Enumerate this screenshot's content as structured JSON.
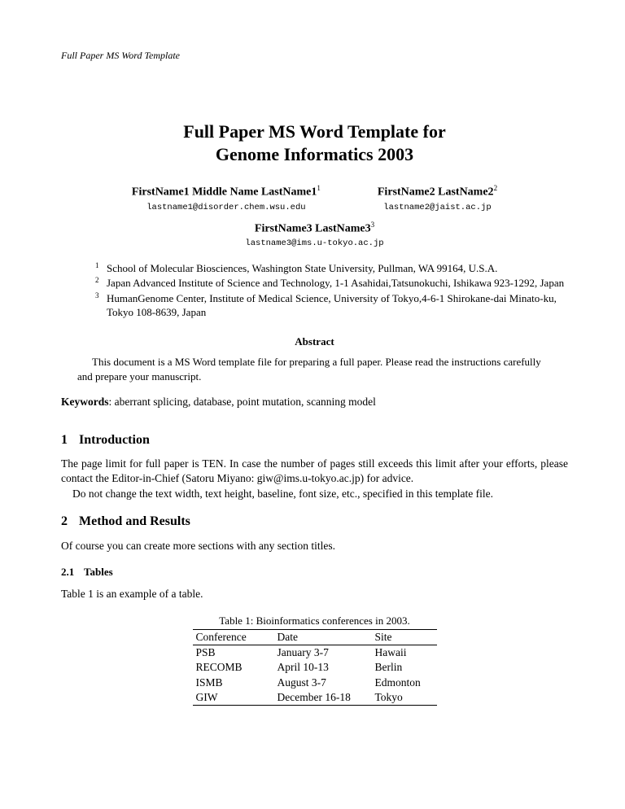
{
  "running_header": "Full Paper MS Word Template",
  "title_line1": "Full Paper MS Word Template for",
  "title_line2": "Genome Informatics 2003",
  "authors": [
    {
      "name": "FirstName1 Middle Name LastName1",
      "sup": "1",
      "email": "lastname1@disorder.chem.wsu.edu"
    },
    {
      "name": "FirstName2 LastName2",
      "sup": "2",
      "email": "lastname2@jaist.ac.jp"
    },
    {
      "name": "FirstName3 LastName3",
      "sup": "3",
      "email": "lastname3@ims.u-tokyo.ac.jp"
    }
  ],
  "affiliations": [
    {
      "sup": "1",
      "text": "School of Molecular Biosciences, Washington State University, Pullman, WA 99164, U.S.A."
    },
    {
      "sup": "2",
      "text": " Japan Advanced Institute of Science and Technology, 1-1 Asahidai,Tatsunokuchi, Ishikawa 923-1292, Japan"
    },
    {
      "sup": "3",
      "text": " HumanGenome Center, Institute of Medical Science, University of Tokyo,4-6-1 Shirokane-dai Minato-ku, Tokyo 108-8639, Japan"
    }
  ],
  "abstract": {
    "heading": "Abstract",
    "text": "This document is a MS Word template file for preparing a full paper. Please read the instructions carefully and prepare your manuscript."
  },
  "keywords": {
    "label": "Keywords",
    "text": ": aberrant splicing, database, point mutation, scanning model"
  },
  "sections": {
    "s1": {
      "num": "1",
      "title": "Introduction",
      "para1": "The page limit for full paper is TEN.   In case the number of pages still exceeds this limit after your efforts, please contact the Editor-in-Chief (Satoru Miyano: giw@ims.u-tokyo.ac.jp) for advice.",
      "para2": "Do not change the text width, text height, baseline, font size, etc., specified in this template file."
    },
    "s2": {
      "num": "2",
      "title": "Method and Results",
      "para1": "Of course you can create more sections with any section titles."
    },
    "s2_1": {
      "num": "2.1",
      "title": "Tables",
      "para1": "Table 1 is an example of a table."
    }
  },
  "table": {
    "caption": "Table 1: Bioinformatics conferences in 2003.",
    "headers": [
      "Conference",
      "Date",
      "Site"
    ],
    "rows": [
      [
        "PSB",
        "January 3-7",
        "Hawaii"
      ],
      [
        "RECOMB",
        "April 10-13",
        "Berlin"
      ],
      [
        "ISMB",
        "August 3-7",
        "Edmonton"
      ],
      [
        "GIW",
        "December 16-18",
        "Tokyo"
      ]
    ]
  }
}
